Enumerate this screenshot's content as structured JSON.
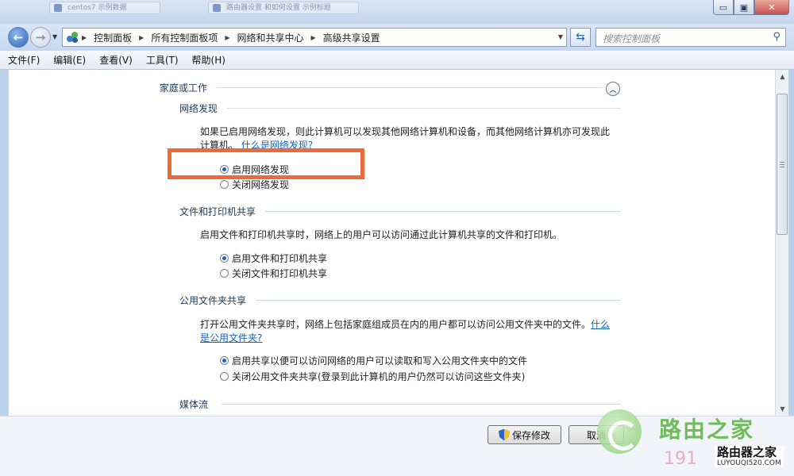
{
  "window": {
    "ghost_tabs": [
      "centos7 示例数据",
      "路由器设置 和如何设置 示例标题"
    ],
    "buttons": {
      "minimize": "▭",
      "restore": "▣",
      "close": "✕"
    }
  },
  "address_bar": {
    "breadcrumbs": [
      "控制面板",
      "所有控制面板项",
      "网络和共享中心",
      "高级共享设置"
    ],
    "search_placeholder": "搜索控制面板"
  },
  "menu": [
    "文件(F)",
    "编辑(E)",
    "查看(V)",
    "工具(T)",
    "帮助(H)"
  ],
  "content": {
    "profile_heading": "家庭或工作",
    "sections": {
      "discovery": {
        "title": "网络发现",
        "desc_line1": "如果已启用网络发现，则此计算机可以发现其他网络计算机和设备，而其他网络计算机亦可发现此",
        "desc_line2_prefix": "计算机。",
        "link": "什么是网络发现?",
        "options": [
          "启用网络发现",
          "关闭网络发现"
        ],
        "selected": 0
      },
      "file_sharing": {
        "title": "文件和打印机共享",
        "desc": "启用文件和打印机共享时，网络上的用户可以访问通过此计算机共享的文件和打印机。",
        "options": [
          "启用文件和打印机共享",
          "关闭文件和打印机共享"
        ],
        "selected": 0
      },
      "public_folder": {
        "title": "公用文件夹共享",
        "desc": "打开公用文件夹共享时，网络上包括家庭组成员在内的用户都可以访问公用文件夹中的文件。",
        "link_part1": "什么",
        "link_part2": "是公用文件夹?",
        "options": [
          "启用共享以便可以访问网络的用户可以读取和写入公用文件夹中的文件",
          "关闭公用文件夹共享(登录到此计算机的用户仍然可以访问这些文件夹)"
        ],
        "selected": 0
      },
      "media": {
        "title": "媒体流"
      }
    }
  },
  "footer": {
    "save_label": "保存修改",
    "cancel_label": "取消"
  },
  "watermark": {
    "brand": "路由之家",
    "number": "191",
    "site_title": "路由器之家",
    "site_url": "LUYOUQI520.COM"
  },
  "colors": {
    "highlight_box": "#ef6a3b",
    "link": "#1565c0",
    "heading": "#1e395b"
  }
}
